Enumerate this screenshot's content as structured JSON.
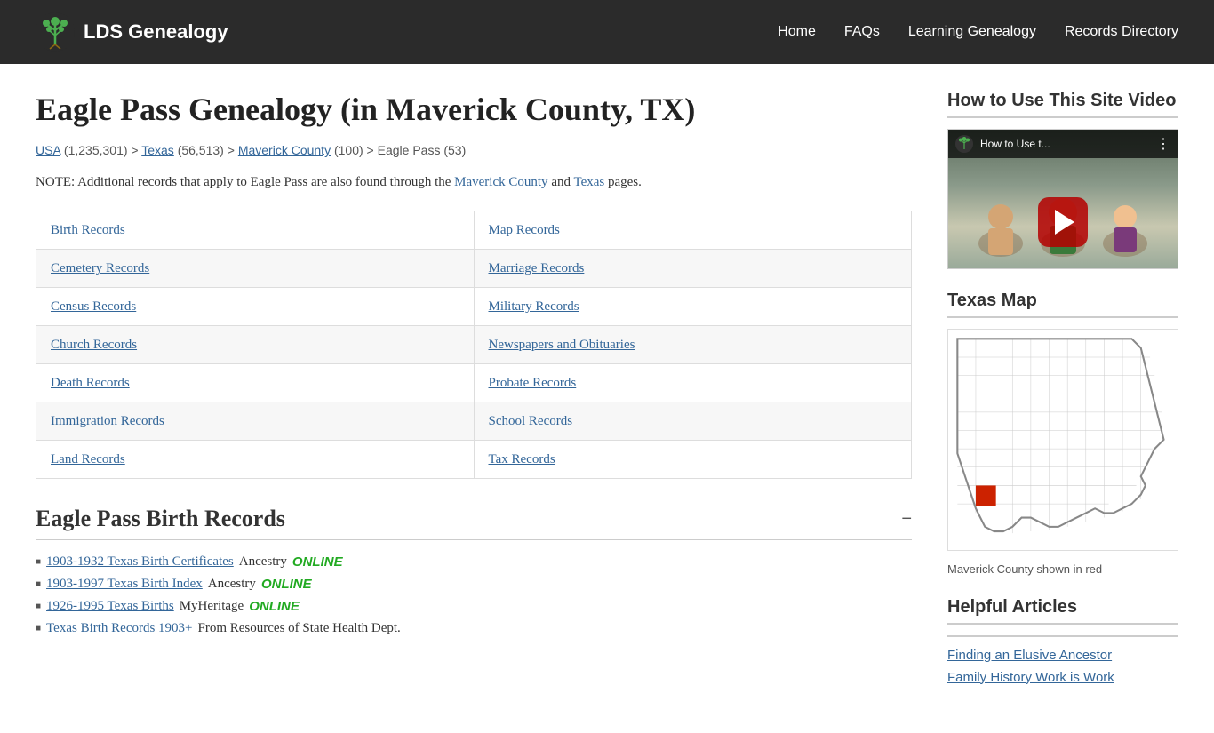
{
  "header": {
    "logo_text": "LDS Genealogy",
    "nav_items": [
      {
        "label": "Home",
        "href": "#"
      },
      {
        "label": "FAQs",
        "href": "#"
      },
      {
        "label": "Learning Genealogy",
        "href": "#"
      },
      {
        "label": "Records Directory",
        "href": "#"
      }
    ]
  },
  "main": {
    "page_title": "Eagle Pass Genealogy (in Maverick County, TX)",
    "breadcrumb": {
      "usa_label": "USA",
      "usa_count": "(1,235,301)",
      "texas_label": "Texas",
      "texas_count": "(56,513)",
      "maverick_label": "Maverick County",
      "maverick_count": "(100)",
      "eagle_pass": "Eagle Pass (53)"
    },
    "note": "NOTE: Additional records that apply to Eagle Pass are also found through the Maverick County and Texas pages.",
    "records_table": [
      {
        "left": "Birth Records",
        "right": "Map Records"
      },
      {
        "left": "Cemetery Records",
        "right": "Marriage Records"
      },
      {
        "left": "Census Records",
        "right": "Military Records"
      },
      {
        "left": "Church Records",
        "right": "Newspapers and Obituaries"
      },
      {
        "left": "Death Records",
        "right": "Probate Records"
      },
      {
        "left": "Immigration Records",
        "right": "School Records"
      },
      {
        "left": "Land Records",
        "right": "Tax Records"
      }
    ],
    "birth_section": {
      "heading": "Eagle Pass Birth Records",
      "collapse_btn": "−",
      "records": [
        {
          "link": "1903-1932 Texas Birth Certificates",
          "provider": "Ancestry",
          "online": "ONLINE"
        },
        {
          "link": "1903-1997 Texas Birth Index",
          "provider": "Ancestry",
          "online": "ONLINE"
        },
        {
          "link": "1926-1995 Texas Births",
          "provider": "MyHeritage",
          "online": "ONLINE"
        },
        {
          "link": "Texas Birth Records 1903+",
          "provider": "From Resources of State Health Dept.",
          "online": ""
        }
      ]
    }
  },
  "sidebar": {
    "video_section": {
      "heading": "How to Use This Site Video",
      "video_title": "How to Use t..."
    },
    "texas_map": {
      "heading": "Texas Map",
      "caption": "Maverick County shown in red"
    },
    "helpful_articles": {
      "heading": "Helpful Articles",
      "articles": [
        {
          "label": "Finding an Elusive Ancestor",
          "href": "#"
        },
        {
          "label": "Family History Work is Work",
          "href": "#"
        }
      ]
    }
  }
}
